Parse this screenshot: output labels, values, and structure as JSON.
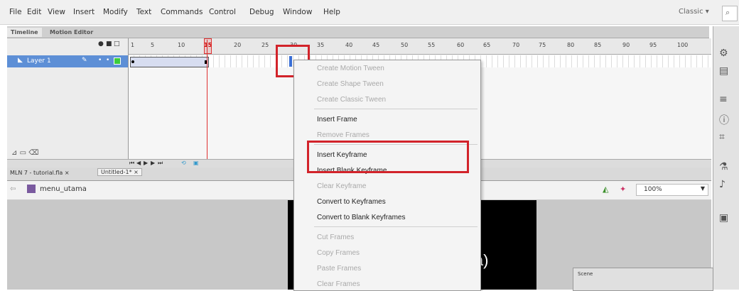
{
  "menubar": {
    "items": [
      "File",
      "Edit",
      "View",
      "Insert",
      "Modify",
      "Text",
      "Commands",
      "Control",
      "Debug",
      "Window",
      "Help"
    ],
    "workspace": "Classic",
    "workspace_caret": "▾"
  },
  "timeline": {
    "tabs": [
      "Timeline",
      "Motion Editor"
    ],
    "ruler_labels": [
      "1",
      "5",
      "10",
      "15",
      "20",
      "25",
      "30",
      "35",
      "40",
      "45",
      "50",
      "55",
      "60",
      "65",
      "70",
      "75",
      "80",
      "85",
      "90",
      "95",
      "100"
    ],
    "layer_name": "Layer 1",
    "playhead_frame": "15"
  },
  "doc_tabs": [
    "MLN 7 - tutorial.fla",
    "Untitled-1*"
  ],
  "breadcrumb": {
    "scene": "menu_utama",
    "zoom": "100%"
  },
  "stage_text": "ia)",
  "context_menu": {
    "items": [
      {
        "label": "Create Motion Tween",
        "enabled": false
      },
      {
        "label": "Create Shape Tween",
        "enabled": false
      },
      {
        "label": "Create Classic Tween",
        "enabled": false
      },
      {
        "label": "Insert Frame",
        "enabled": true
      },
      {
        "label": "Remove Frames",
        "enabled": false
      },
      {
        "label": "Insert Keyframe",
        "enabled": true
      },
      {
        "label": "Insert Blank Keyframe",
        "enabled": true
      },
      {
        "label": "Clear Keyframe",
        "enabled": false
      },
      {
        "label": "Convert to Keyframes",
        "enabled": true
      },
      {
        "label": "Convert to Blank Keyframes",
        "enabled": true
      },
      {
        "label": "Cut Frames",
        "enabled": false
      },
      {
        "label": "Copy Frames",
        "enabled": false
      },
      {
        "label": "Paste Frames",
        "enabled": false
      },
      {
        "label": "Clear Frames",
        "enabled": false
      }
    ]
  },
  "scene_panel": {
    "title": "Scene"
  },
  "colors": {
    "highlight": "#d2232a",
    "layer_selected": "#5d8fd6",
    "playhead": "#e03030"
  }
}
